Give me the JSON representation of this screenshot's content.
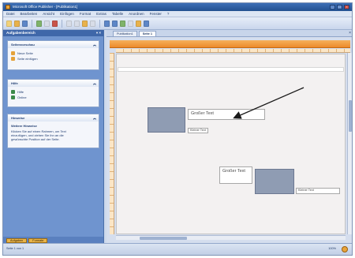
{
  "window": {
    "title": "Microsoft Office Publisher - [Publikation1]",
    "controls": {
      "minimize": "_",
      "maximize": "□",
      "close": "×"
    }
  },
  "menubar": {
    "items": [
      "Datei",
      "Bearbeiten",
      "Ansicht",
      "Einfügen",
      "Format",
      "Extras",
      "Tabelle",
      "Anordnen",
      "Fenster",
      "?"
    ]
  },
  "taskpane": {
    "title": "Aufgabenbereich",
    "pin": "▾ ×",
    "panels": [
      {
        "heading": "Seitenvorschau",
        "chevron": "︽",
        "rows": [
          {
            "label": "Neue Seite",
            "icon_color": "#e5a23a"
          },
          {
            "label": "Seite einfügen",
            "icon_color": "#e5a23a"
          }
        ]
      },
      {
        "heading": "Hilfe",
        "chevron": "︽",
        "rows": [
          {
            "label": "Hilfe",
            "icon_color": "#3c8a4a"
          },
          {
            "label": "Online",
            "icon_color": "#3c8a4a"
          }
        ]
      },
      {
        "heading": "Hinweise",
        "chevron": "︽",
        "lines": [
          {
            "text": "Weitere Hinweise",
            "bold": true
          },
          {
            "text": "Klicken Sie auf einen Rahmen, um Text",
            "bold": false
          },
          {
            "text": "einzufügen, und ziehen Sie ihn an die",
            "bold": false
          },
          {
            "text": "gewünschte Position auf der Seite.",
            "bold": false
          }
        ]
      }
    ],
    "tabs": [
      "Aufgaben",
      "Formate"
    ]
  },
  "document": {
    "tabs": [
      {
        "label": "Publikation1",
        "active": false
      },
      {
        "label": "Seite 1",
        "active": true
      }
    ],
    "close": "×"
  },
  "canvas": {
    "textbox_1": "Großer Text",
    "field_1": "Kleiner Text",
    "textbox_2": "Großer Text",
    "field_2": "Kleiner Text"
  },
  "statusbar": {
    "left": "Seite 1 von 1",
    "right": "100%"
  },
  "colors": {
    "titlebar": "#2f5ea3",
    "taskpane": "#6f94cf",
    "ribbon": "#ed8a2a",
    "image_placeholder": "#8f9cb3",
    "arrow": "#1a1a1a"
  },
  "icons": [
    "app-icon",
    "chevron-up-icon",
    "pin-icon",
    "close-icon",
    "arrow-annotation-icon",
    "status-icon"
  ]
}
